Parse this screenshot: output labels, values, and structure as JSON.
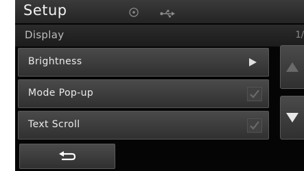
{
  "header": {
    "title": "Setup",
    "icons": [
      "disc-icon",
      "usb-icon"
    ]
  },
  "subheader": {
    "title": "Display",
    "page_indicator": "1/"
  },
  "menu": [
    {
      "label": "Brightness",
      "control": "arrow-right-icon"
    },
    {
      "label": "Mode Pop-up",
      "control": "checkbox",
      "checked": true
    },
    {
      "label": "Text Scroll",
      "control": "checkbox",
      "checked": true
    }
  ],
  "scroll": {
    "up": {
      "icon": "scroll-up-icon",
      "enabled": false
    },
    "down": {
      "icon": "scroll-down-icon",
      "enabled": true
    }
  },
  "back_button": {
    "icon": "back-arrow-icon"
  },
  "colors": {
    "background": "#050505",
    "bar": "#2e2e2e",
    "button": "#3d3d3d",
    "text": "#ececec",
    "muted_text": "#bdbdbd"
  }
}
